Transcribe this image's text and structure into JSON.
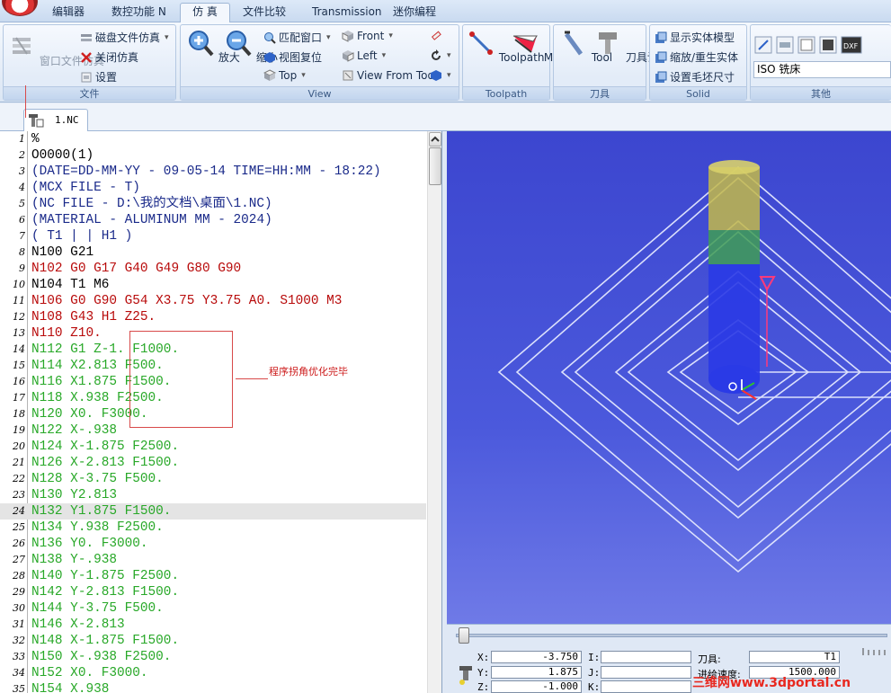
{
  "tabs": [
    "编辑器",
    "数控功能 N",
    "仿 真",
    "文件比较",
    "Transmission",
    "迷你编程"
  ],
  "ribbon": {
    "file": {
      "label": "文件",
      "window_sim": "窗口文件仿真",
      "disk_sim": "磁盘文件仿真",
      "close_sim": "关闭仿真",
      "settings": "设置"
    },
    "view": {
      "label": "View",
      "zoom_in": "放大",
      "zoom_out": "缩小",
      "fit_window": "匹配窗口",
      "reset_view": "视图复位",
      "top": "Top",
      "front": "Front",
      "left": "Left",
      "view_from_tool": "View From Tool"
    },
    "toolpath": {
      "label": "Toolpath",
      "toolpath": "Toolpath",
      "mode": "Mode"
    },
    "tool": {
      "label": "刀具",
      "tool": "Tool",
      "tool_settings": "刀具设置"
    },
    "solid": {
      "label": "Solid",
      "show_solid": "显示实体模型",
      "scale_regen": "缩放/重生实体",
      "stock_size": "设置毛坯尺寸"
    },
    "other": {
      "label": "其他",
      "machine": "ISO 铣床"
    }
  },
  "doc_tab": "1.NC",
  "code_lines": [
    {
      "n": "1",
      "t": "%",
      "c": "black"
    },
    {
      "n": "2",
      "t": "O0000(1)",
      "c": "black"
    },
    {
      "n": "3",
      "t": "(DATE=DD-MM-YY - 09-05-14 TIME=HH:MM - 18:22)",
      "c": "blue"
    },
    {
      "n": "4",
      "t": "(MCX FILE - T)",
      "c": "blue"
    },
    {
      "n": "5",
      "t": "(NC FILE - D:\\我的文档\\桌面\\1.NC)",
      "c": "blue"
    },
    {
      "n": "6",
      "t": "(MATERIAL - ALUMINUM MM - 2024)",
      "c": "blue"
    },
    {
      "n": "7",
      "t": "( T1 | | H1 )",
      "c": "blue"
    },
    {
      "n": "8",
      "t": "N100 G21",
      "c": "black"
    },
    {
      "n": "9",
      "t": "N102 G0 G17 G40 G49 G80 G90",
      "c": "red"
    },
    {
      "n": "10",
      "t": "N104 T1 M6",
      "c": "black"
    },
    {
      "n": "11",
      "t": "N106 G0 G90 G54 X3.75 Y3.75 A0. S1000 M3",
      "c": "red"
    },
    {
      "n": "12",
      "t": "N108 G43 H1 Z25.",
      "c": "red"
    },
    {
      "n": "13",
      "t": "N110 Z10.",
      "c": "red"
    },
    {
      "n": "14",
      "t": "N112 G1 Z-1. F1000.",
      "c": "green"
    },
    {
      "n": "15",
      "t": "N114 X2.813 F500.",
      "c": "green"
    },
    {
      "n": "16",
      "t": "N116 X1.875 F1500.",
      "c": "green"
    },
    {
      "n": "17",
      "t": "N118 X.938 F2500.",
      "c": "green"
    },
    {
      "n": "18",
      "t": "N120 X0. F3000.",
      "c": "green"
    },
    {
      "n": "19",
      "t": "N122 X-.938",
      "c": "green"
    },
    {
      "n": "20",
      "t": "N124 X-1.875 F2500.",
      "c": "green"
    },
    {
      "n": "21",
      "t": "N126 X-2.813 F1500.",
      "c": "green"
    },
    {
      "n": "22",
      "t": "N128 X-3.75 F500.",
      "c": "green"
    },
    {
      "n": "23",
      "t": "N130 Y2.813",
      "c": "green"
    },
    {
      "n": "24",
      "t": "N132 Y1.875 F1500.",
      "c": "green"
    },
    {
      "n": "25",
      "t": "N134 Y.938 F2500.",
      "c": "green"
    },
    {
      "n": "26",
      "t": "N136 Y0. F3000.",
      "c": "green"
    },
    {
      "n": "27",
      "t": "N138 Y-.938",
      "c": "green"
    },
    {
      "n": "28",
      "t": "N140 Y-1.875 F2500.",
      "c": "green"
    },
    {
      "n": "29",
      "t": "N142 Y-2.813 F1500.",
      "c": "green"
    },
    {
      "n": "30",
      "t": "N144 Y-3.75 F500.",
      "c": "green"
    },
    {
      "n": "31",
      "t": "N146 X-2.813",
      "c": "green"
    },
    {
      "n": "32",
      "t": "N148 X-1.875 F1500.",
      "c": "green"
    },
    {
      "n": "33",
      "t": "N150 X-.938 F2500.",
      "c": "green"
    },
    {
      "n": "34",
      "t": "N152 X0. F3000.",
      "c": "green"
    },
    {
      "n": "35",
      "t": "N154 X.938",
      "c": "green"
    }
  ],
  "current_line": 24,
  "annotation": "程序拐角优化完毕",
  "coords": {
    "x_label": "X:",
    "x": "-3.750",
    "y_label": "Y:",
    "y": "1.875",
    "z_label": "Z:",
    "z": "-1.000",
    "i_label": "I:",
    "j_label": "J:",
    "k_label": "K:",
    "tool_label": "刀具:",
    "tool": "T1",
    "feed_label": "进给速度:",
    "feed": "1500.000"
  },
  "watermark": "三维网www.3dportal.cn",
  "colors": {
    "code_black": "#000000",
    "code_blue": "#1a2a8a",
    "code_red": "#b80a0a",
    "code_green": "#28a828",
    "viewport_bg": "#4b59dc"
  }
}
